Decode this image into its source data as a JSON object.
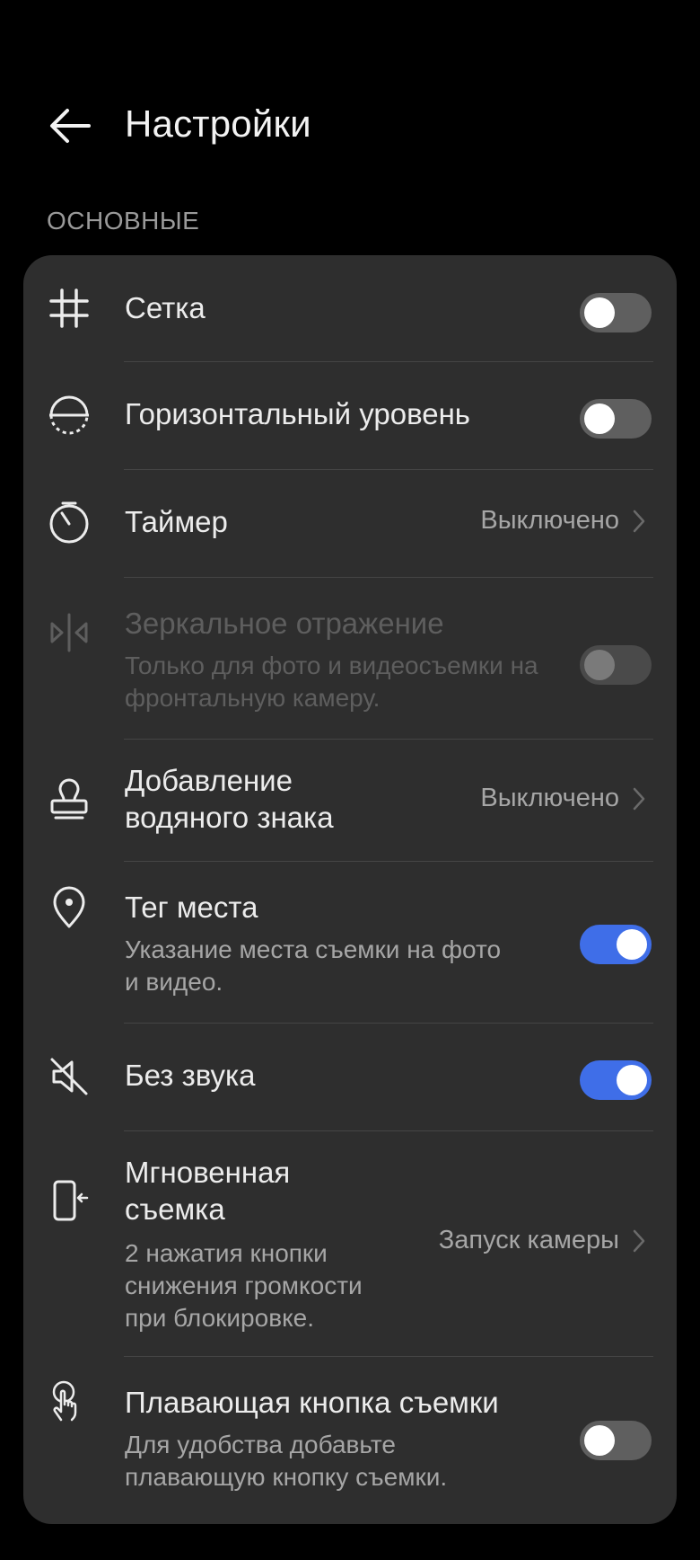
{
  "header": {
    "title": "Настройки",
    "back_icon": "arrow-left-icon"
  },
  "section": {
    "label": "ОСНОВНЫЕ"
  },
  "colors": {
    "accent": "#3f6ee8",
    "card": "#2e2e2e",
    "background": "#000000"
  },
  "settings": [
    {
      "icon": "grid-icon",
      "label": "Сетка",
      "control": "toggle",
      "on": false
    },
    {
      "icon": "horizon-level-icon",
      "label": "Горизонтальный уровень",
      "control": "toggle",
      "on": false
    },
    {
      "icon": "timer-icon",
      "label": "Таймер",
      "control": "value",
      "value": "Выключено"
    },
    {
      "icon": "mirror-icon",
      "label": "Зеркальное отражение",
      "sub": "Только для фото и видеосъемки на фронтальную камеру.",
      "control": "toggle",
      "on": false,
      "disabled": true
    },
    {
      "icon": "stamp-icon",
      "label_line1": "Добавление",
      "label_line2": "водяного знака",
      "control": "value",
      "value": "Выключено"
    },
    {
      "icon": "location-pin-icon",
      "label": "Тег места",
      "sub_line1": "Указание места съемки на фото",
      "sub_line2": "и видео.",
      "control": "toggle",
      "on": true
    },
    {
      "icon": "mute-icon",
      "label": "Без звука",
      "control": "toggle",
      "on": true
    },
    {
      "icon": "phone-volume-button-icon",
      "label_line1": "Мгновенная",
      "label_line2": "съемка",
      "sub_line1": "2 нажатия кнопки",
      "sub_line2": "снижения громкости",
      "sub_line3": "при блокировке.",
      "control": "value",
      "value": "Запуск камеры"
    },
    {
      "icon": "touch-hand-icon",
      "label": "Плавающая кнопка съемки",
      "sub_line1": "Для удобства добавьте",
      "sub_line2": "плавающую кнопку съемки.",
      "control": "toggle",
      "on": false
    }
  ]
}
